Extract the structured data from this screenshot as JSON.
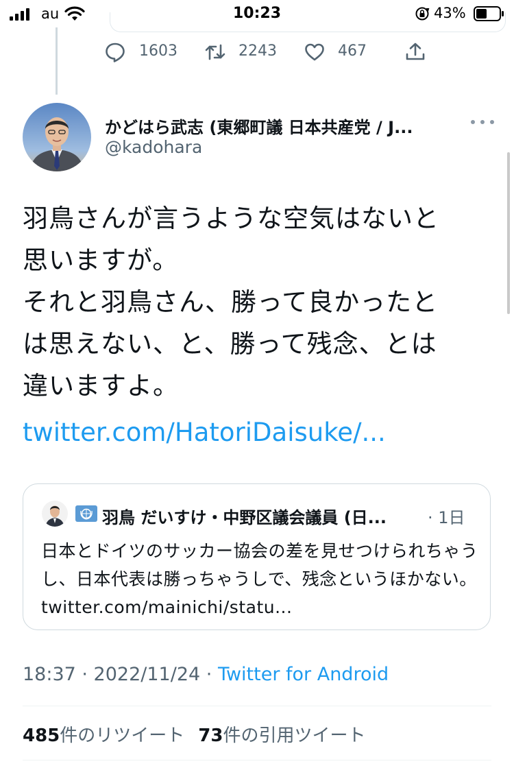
{
  "status_bar": {
    "carrier": "au",
    "time": "10:23",
    "battery_percent": "43%"
  },
  "previous_tweet_actions": {
    "replies": "1603",
    "retweets": "2243",
    "likes": "467"
  },
  "tweet": {
    "author_name": "かどはら武志 (東郷町議 日本共産党 / J...",
    "author_handle": "@kadohara",
    "body_lines": [
      "羽鳥さんが言うような空気はないと",
      "思いますが。",
      "それと羽鳥さん、勝って良かったと",
      "は思えない、と、勝って残念、とは",
      "違いますよ。"
    ],
    "link": "twitter.com/HatoriDaisuke/...",
    "timestamp": "18:37 · 2022/11/24 · ",
    "source": "Twitter for Android"
  },
  "quote": {
    "author_name": "羽鳥 だいすけ・中野区議会議員 (日...",
    "time": "· 1日",
    "text": "日本とドイツのサッカー協会の差を見せつけられちゃうし、日本代表は勝っちゃうしで、残念というほかない。 twitter.com/mainichi/statu..."
  },
  "stats": {
    "retweet_count": "485",
    "retweet_label": "件のリツイート",
    "quote_count": "73",
    "quote_label": "件の引用ツイート"
  },
  "colors": {
    "link": "#1d9bf0",
    "secondary_text": "#536471",
    "primary_text": "#0f1419"
  },
  "icons": {
    "reply": "reply-icon",
    "retweet": "retweet-icon",
    "like": "heart-icon",
    "share": "share-icon",
    "more": "more-icon"
  }
}
